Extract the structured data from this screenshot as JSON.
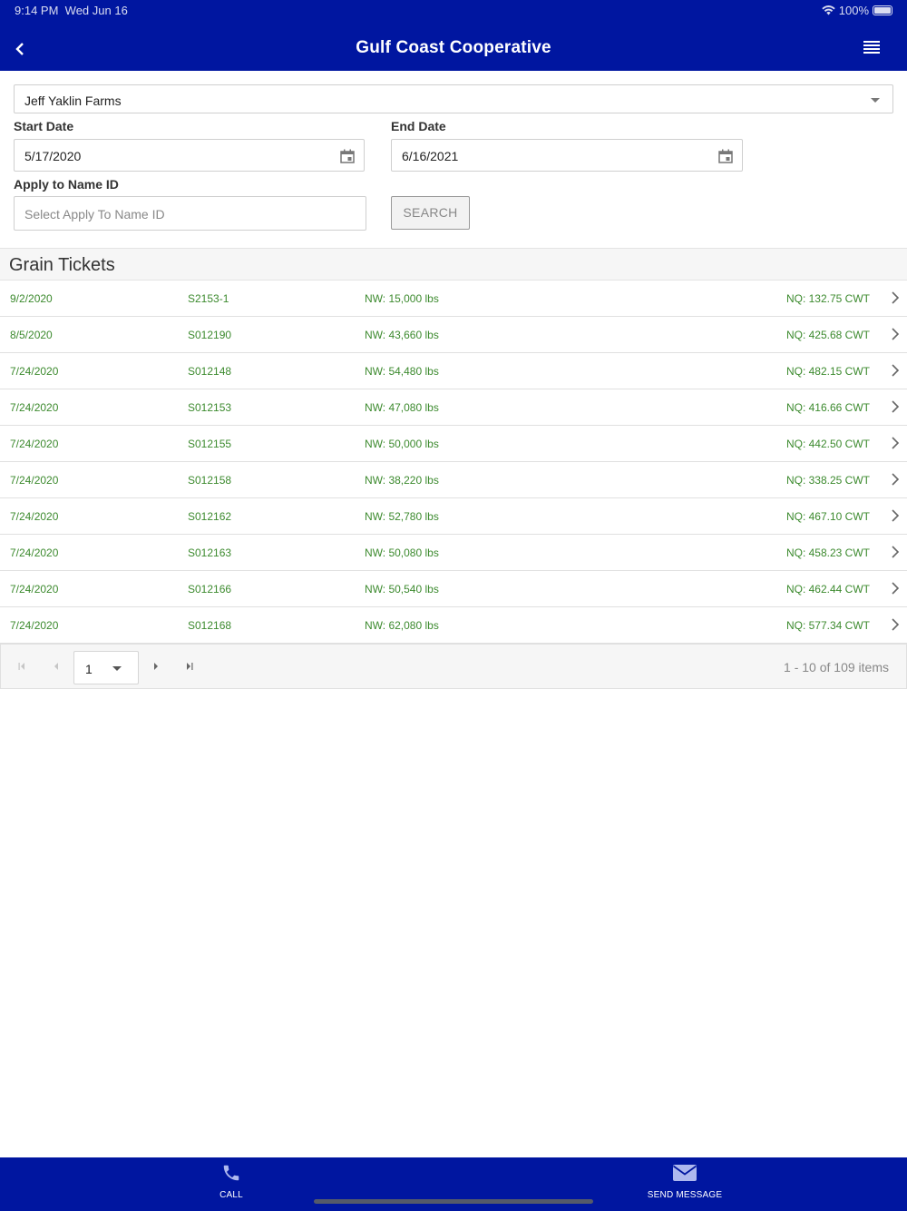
{
  "status_bar": {
    "time": "9:14 PM",
    "date": "Wed Jun 16",
    "battery": "100%"
  },
  "header": {
    "title": "Gulf Coast Cooperative"
  },
  "filters": {
    "farm": "Jeff Yaklin Farms",
    "start_date_label": "Start Date",
    "start_date": "5/17/2020",
    "end_date_label": "End Date",
    "end_date": "6/16/2021",
    "apply_label": "Apply to Name ID",
    "apply_placeholder": "Select Apply To Name ID",
    "search_label": "SEARCH"
  },
  "section_title": "Grain Tickets",
  "tickets": [
    {
      "date": "9/2/2020",
      "ticket": "S2153-1",
      "nw": "NW: 15,000 lbs",
      "nq": "NQ: 132.75 CWT"
    },
    {
      "date": "8/5/2020",
      "ticket": "S012190",
      "nw": "NW: 43,660 lbs",
      "nq": "NQ: 425.68 CWT"
    },
    {
      "date": "7/24/2020",
      "ticket": "S012148",
      "nw": "NW: 54,480 lbs",
      "nq": "NQ: 482.15 CWT"
    },
    {
      "date": "7/24/2020",
      "ticket": "S012153",
      "nw": "NW: 47,080 lbs",
      "nq": "NQ: 416.66 CWT"
    },
    {
      "date": "7/24/2020",
      "ticket": "S012155",
      "nw": "NW: 50,000 lbs",
      "nq": "NQ: 442.50 CWT"
    },
    {
      "date": "7/24/2020",
      "ticket": "S012158",
      "nw": "NW: 38,220 lbs",
      "nq": "NQ: 338.25 CWT"
    },
    {
      "date": "7/24/2020",
      "ticket": "S012162",
      "nw": "NW: 52,780 lbs",
      "nq": "NQ: 467.10 CWT"
    },
    {
      "date": "7/24/2020",
      "ticket": "S012163",
      "nw": "NW: 50,080 lbs",
      "nq": "NQ: 458.23 CWT"
    },
    {
      "date": "7/24/2020",
      "ticket": "S012166",
      "nw": "NW: 50,540 lbs",
      "nq": "NQ: 462.44 CWT"
    },
    {
      "date": "7/24/2020",
      "ticket": "S012168",
      "nw": "NW: 62,080 lbs",
      "nq": "NQ: 577.34 CWT"
    }
  ],
  "pager": {
    "page": "1",
    "info": "1 - 10 of 109 items"
  },
  "footer": {
    "call_label": "CALL",
    "message_label": "SEND MESSAGE"
  },
  "colors": {
    "header_bg": "#0016a0",
    "ticket_text": "#3c8a2e",
    "section_bg": "#f6f6f6"
  },
  "icons": [
    "back-chevron-icon",
    "hamburger-menu-icon",
    "calendar-icon",
    "chevron-right-icon",
    "first-page-icon",
    "prev-page-icon",
    "next-page-icon",
    "last-page-icon",
    "phone-icon",
    "envelope-icon",
    "wifi-icon",
    "battery-icon"
  ]
}
